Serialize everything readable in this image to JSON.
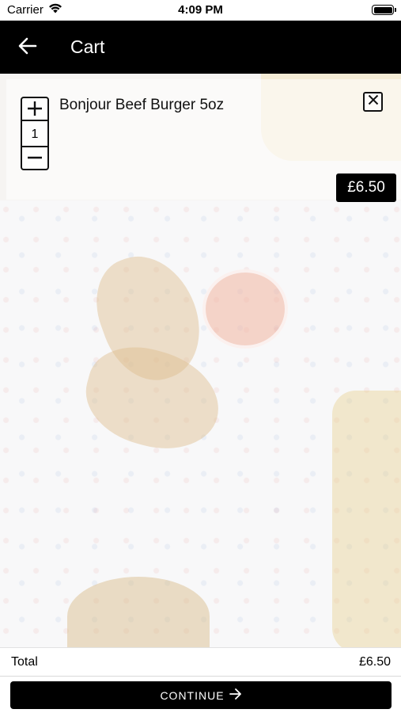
{
  "status_bar": {
    "carrier": "Carrier",
    "time": "4:09 PM",
    "battery_level": 1.0
  },
  "header": {
    "title": "Cart",
    "back_icon": "arrow-left-icon"
  },
  "cart": {
    "items": [
      {
        "name": "Bonjour Beef Burger 5oz",
        "quantity": "1",
        "price": "£6.50",
        "increment_icon": "plus-icon",
        "decrement_icon": "minus-icon",
        "remove_icon": "close-icon"
      }
    ]
  },
  "footer": {
    "total_label": "Total",
    "total_value": "£6.50",
    "continue_label": "CONTINUE",
    "continue_icon": "arrow-right-icon"
  },
  "colors": {
    "header_bg": "#000000",
    "accent": "#000000",
    "text": "#111111"
  }
}
